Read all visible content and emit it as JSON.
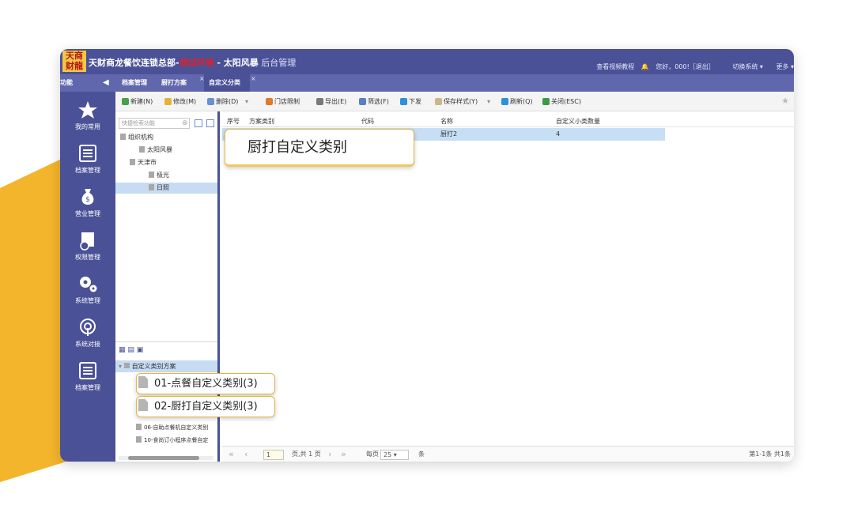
{
  "colors": {
    "accent_yellow": "#f3b52b",
    "header_bg": "#4a5196",
    "tab_bg": "#6067ad",
    "selected_row": "#c6dff4",
    "callout_border": "#e8b53e"
  },
  "app": {
    "logo_line1": "天商",
    "logo_line2": "财龍",
    "title_main": "天财商龙餐饮连锁总部-",
    "title_red": "测试环境",
    "title_store": " - 太阳风暴",
    "title_admin": " 后台管理"
  },
  "topright": {
    "video": "查看视频教程",
    "greeting": "您好，000!［退出］",
    "switch": "切换系统 ▾",
    "more": "更多 ▾"
  },
  "tabs": {
    "func_label": "功能",
    "tab1": "档案管理",
    "tab2": "厨打方案",
    "tab3": "自定义分类"
  },
  "sidebar": {
    "item1": "我的常用",
    "item2": "档案管理",
    "item3": "营业管理",
    "item4": "权限管理",
    "item5": "系统管理",
    "item6": "系统对接",
    "item7": "档案管理"
  },
  "toolbar": {
    "new": "新建(N)",
    "edit": "修改(M)",
    "delete": "删除(D)",
    "store_limit": "门店限制",
    "export": "导出(E)",
    "filter": "筛选(F)",
    "issue": "下发",
    "save_style": "保存样式(Y)",
    "refresh": "刷新(Q)",
    "close": "关闭(ESC)"
  },
  "leftpanel": {
    "search_placeholder": "快捷检索功能",
    "tree": {
      "root": "组织机构",
      "n1": "太阳风暴",
      "n2": "天津市",
      "n3": "极光",
      "n4": "日照"
    },
    "scheme_root": "自定义类别方案",
    "scheme_item3": "06-自助点餐机自定义类别",
    "scheme_item4": "10-食尚订小程序点餐自定"
  },
  "grid": {
    "columns": [
      "序号",
      "方案类别",
      "代码",
      "名称",
      "自定义小类数量"
    ],
    "row1": {
      "name": "厨打2",
      "count": "4"
    }
  },
  "pager": {
    "page": "1",
    "of_pages": "页,共 1 页",
    "per_page_label": "每页",
    "per_page": "25 ▾",
    "unit": "条",
    "summary": "第1-1条 共1条"
  },
  "callouts": {
    "c1": "厨打自定义类别",
    "c2": "01-点餐自定义类别(3)",
    "c3": "02-厨打自定义类别(3)"
  }
}
